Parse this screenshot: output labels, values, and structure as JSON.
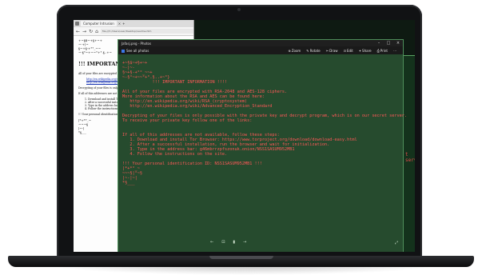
{
  "browser": {
    "tab_label": "Computer Intrusion",
    "tab_close": "×",
    "tab_new": "+",
    "nav_back": "←",
    "nav_forward": "→",
    "nav_reload": "↻",
    "nav_home": "⌂",
    "url": "file:///C:/Users/user/Desktop/readme.htm",
    "ascii_lines": [
      "+~§$~+§+~+",
      "~-+|~",
      "§~+§-+°°_~~",
      "~-§°~+~~°+°.§..+~"
    ],
    "heading": "!!! IMPORTANT I",
    "para1": "All of your files are encrypted More information about the RSA",
    "link1": "http://en.wikipedia.org/wiki/RSA",
    "link2": "http://en.wikipedia.org/wiki/Adv",
    "para2": "Decrypting of your files is only p To receive your private key follow",
    "para3": "If all of this addresses are not av",
    "steps": [
      "Download and install Tor",
      "After a successful install",
      "Type in the address bar:",
      "Follow the instructions o"
    ],
    "para4": "!!! Your personal identification",
    "ascii_tail": [
      "|*+*°_~",
      "~~~§",
      "|~-|",
      "*§___"
    ]
  },
  "photos": {
    "title": "Jafasj.png - Photos",
    "see_all": "See all photos",
    "toolbar": [
      {
        "glyph": "⊕",
        "label": "Zoom"
      },
      {
        "glyph": "✎",
        "label": "Rotate"
      },
      {
        "glyph": "✂",
        "label": "Draw"
      },
      {
        "glyph": "⊡",
        "label": "Edit"
      },
      {
        "glyph": "✦",
        "label": "Share"
      },
      {
        "glyph": "⎙",
        "label": "Print"
      },
      {
        "glyph": "⋯",
        "label": ""
      }
    ],
    "minimize": "–",
    "maximize": "□",
    "close": "×",
    "ransom_note": {
      "ascii_header": [
        "+~§$~+§+~+",
        "~-|~-",
        "§~+§-+°°_~~+",
        "~-§°~+~~°+°.§..+~°}"
      ],
      "heading": "!!! IMPORTANT INFORMATION !!!!",
      "encrypted_line": "All of your files are encrypted with RSA-2048 and AES-128 ciphers.",
      "info_line": "More information about the RSA and AES can be found here:",
      "link_rsa": "http://en.wikipedia.org/wiki/RSA_(cryptosystem)",
      "link_aes": "http://en.wikipedia.org/wiki/Advanced_Encryption_Standard",
      "decrypt_line": "Decrypting of your files is only possible with the private key and decrypt program, which is on our secret server.",
      "receive_line": "To receive your private key follow one of the links:",
      "unavailable_line": "If all of this addresses are not available, follow these steps:",
      "steps": [
        "1. Download and install Tor Browser: https://www.torproject.org/download/download-easy.html",
        "2. After a successful installation, run the browser and wait for initialization.",
        "3. Type in the address bar: g46mbrrzpfszonuk.onion/NSS1SASUM952MB1",
        "4. Follow the instructions on the site."
      ],
      "id_line": "!!! Your personal identification ID: NSS1SASUM952MB1 !!!",
      "ascii_tail": [
        "|*+*°_~",
        "~~~§|°~§",
        "|~-|~|",
        "*§___"
      ]
    },
    "controls": [
      "←",
      "⊡",
      "▮",
      "→"
    ],
    "expand": "⤢"
  },
  "background_window": {
    "fragment": "t server."
  },
  "colors": {
    "note_text": "#ff5858",
    "photos_bg": "#264b2e",
    "photos_border": "#4f8f5b",
    "link": "#1a35b3",
    "bezel": "#111214"
  }
}
